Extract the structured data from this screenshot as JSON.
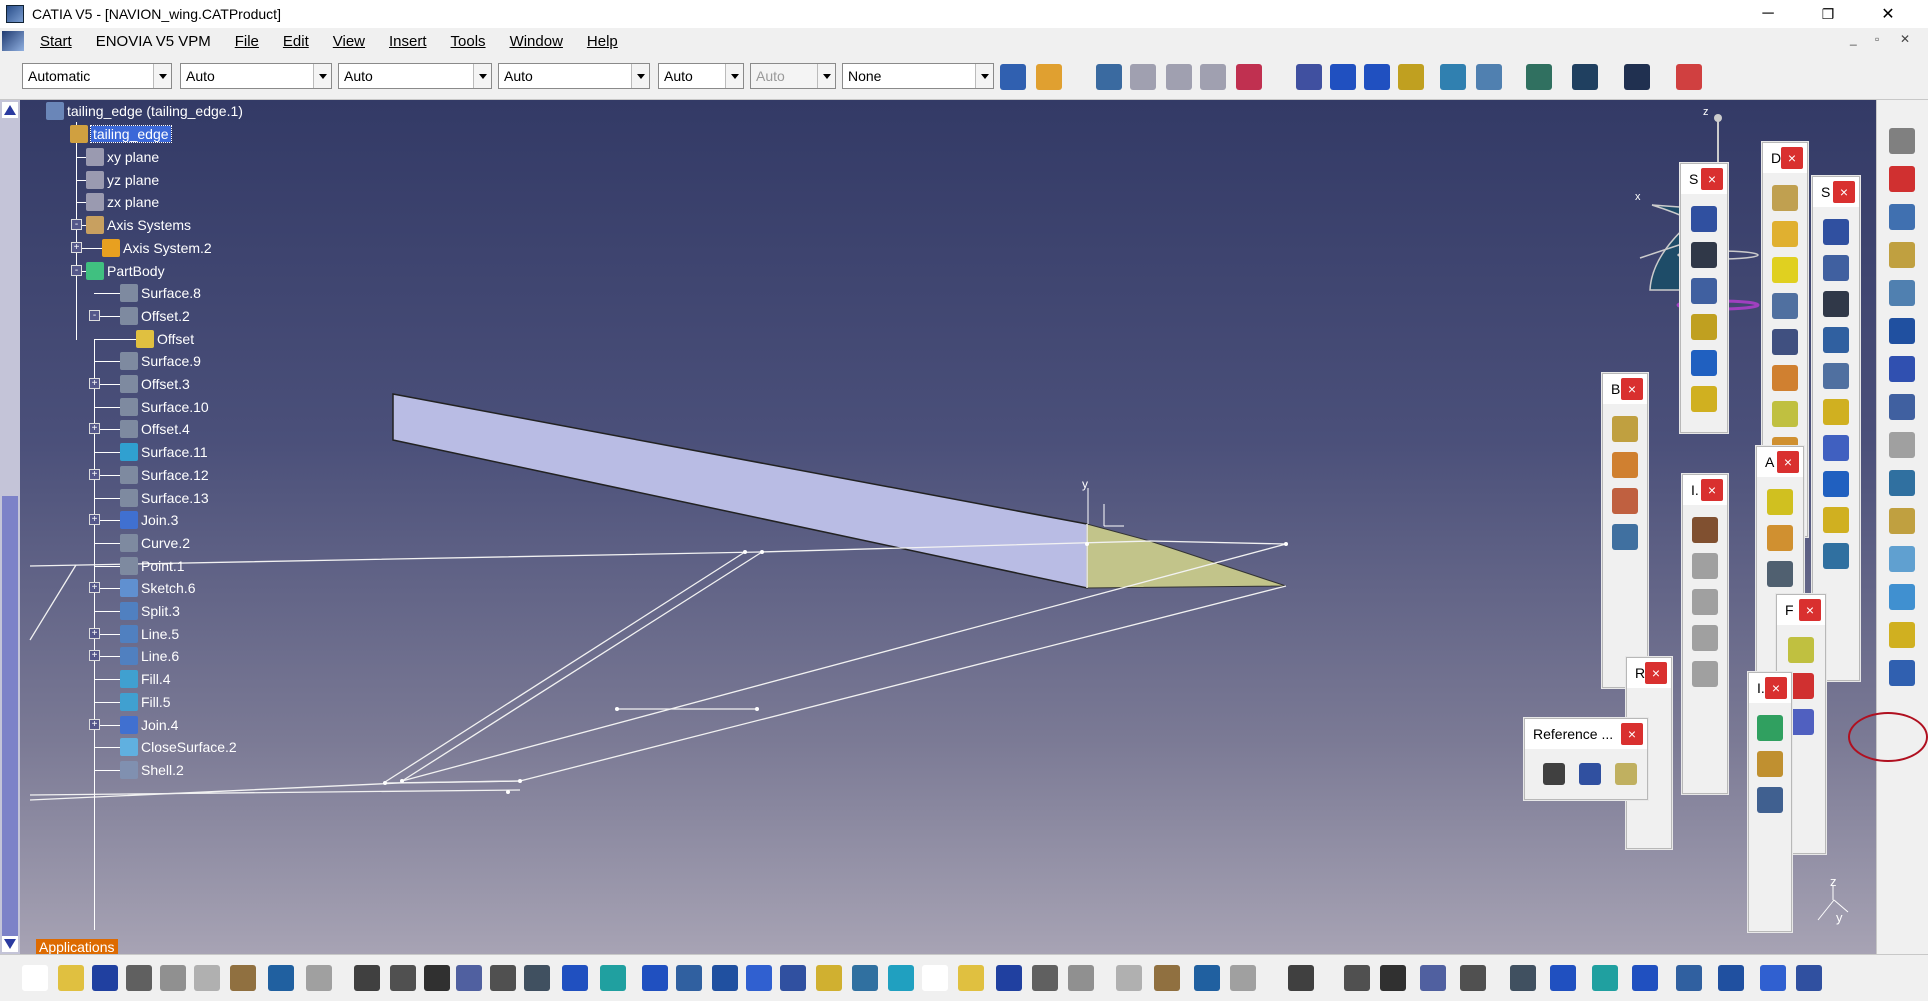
{
  "window": {
    "title": "CATIA V5 - [NAVION_wing.CATProduct]",
    "controls": [
      "─",
      "❐",
      "✕"
    ],
    "doc_controls": [
      "_",
      "▫",
      "✕"
    ]
  },
  "menu": {
    "items": [
      "Start",
      "ENOVIA V5 VPM",
      "File",
      "Edit",
      "View",
      "Insert",
      "Tools",
      "Window",
      "Help"
    ]
  },
  "toolbar": {
    "combos": [
      "Automatic",
      "Auto",
      "Auto",
      "Auto",
      "Auto",
      "Auto",
      "None"
    ],
    "combo_disabled": [
      false,
      false,
      false,
      false,
      false,
      true,
      false
    ]
  },
  "tree": {
    "root": "tailing_edge (tailing_edge.1)",
    "part": "tailing_edge",
    "nodes": [
      {
        "label": "xy plane",
        "icon": "plane-icon",
        "color": "#9a9ab0",
        "expander": ""
      },
      {
        "label": "yz plane",
        "icon": "plane-icon",
        "color": "#9a9ab0",
        "expander": ""
      },
      {
        "label": "zx plane",
        "icon": "plane-icon",
        "color": "#9a9ab0",
        "expander": ""
      },
      {
        "label": "Axis Systems",
        "icon": "axis-systems-icon",
        "color": "#c8a060",
        "expander": "-"
      },
      {
        "label": "Axis System.2",
        "icon": "axis-system-icon",
        "color": "#e8a020",
        "expander": "+"
      },
      {
        "label": "PartBody",
        "icon": "partbody-icon",
        "color": "#40c080",
        "expander": "-"
      },
      {
        "label": "Surface.8",
        "icon": "surface-icon",
        "color": "#7e8aa0",
        "expander": ""
      },
      {
        "label": "Offset.2",
        "icon": "offset-icon",
        "color": "#7e8aa0",
        "expander": "-"
      },
      {
        "label": "Offset",
        "icon": "offset-feature-icon",
        "color": "#e0c040",
        "expander": ""
      },
      {
        "label": "Surface.9",
        "icon": "surface-icon",
        "color": "#7e8aa0",
        "expander": ""
      },
      {
        "label": "Offset.3",
        "icon": "offset-icon",
        "color": "#7e8aa0",
        "expander": "+"
      },
      {
        "label": "Surface.10",
        "icon": "surface-icon",
        "color": "#7e8aa0",
        "expander": ""
      },
      {
        "label": "Offset.4",
        "icon": "offset-icon",
        "color": "#7e8aa0",
        "expander": "+"
      },
      {
        "label": "Surface.11",
        "icon": "surface-icon",
        "color": "#30a0d0",
        "expander": ""
      },
      {
        "label": "Surface.12",
        "icon": "surface-icon",
        "color": "#7e8aa0",
        "expander": "+"
      },
      {
        "label": "Surface.13",
        "icon": "surface-icon",
        "color": "#7e8aa0",
        "expander": ""
      },
      {
        "label": "Join.3",
        "icon": "join-icon",
        "color": "#4070d0",
        "expander": "+"
      },
      {
        "label": "Curve.2",
        "icon": "curve-icon",
        "color": "#7e8aa0",
        "expander": ""
      },
      {
        "label": "Point.1",
        "icon": "point-icon",
        "color": "#7e8aa0",
        "expander": ""
      },
      {
        "label": "Sketch.6",
        "icon": "sketch-icon",
        "color": "#6090d0",
        "expander": "+"
      },
      {
        "label": "Split.3",
        "icon": "split-icon",
        "color": "#5080c0",
        "expander": ""
      },
      {
        "label": "Line.5",
        "icon": "line-icon",
        "color": "#5080c0",
        "expander": "+"
      },
      {
        "label": "Line.6",
        "icon": "line-icon",
        "color": "#5080c0",
        "expander": "+"
      },
      {
        "label": "Fill.4",
        "icon": "fill-icon",
        "color": "#40a0d0",
        "expander": ""
      },
      {
        "label": "Fill.5",
        "icon": "fill-icon",
        "color": "#40a0d0",
        "expander": ""
      },
      {
        "label": "Join.4",
        "icon": "join-icon",
        "color": "#4070d0",
        "expander": "+"
      },
      {
        "label": "CloseSurface.2",
        "icon": "close-surface-icon",
        "color": "#60b0e0",
        "expander": ""
      },
      {
        "label": "Shell.2",
        "icon": "shell-icon",
        "color": "#8090b0",
        "expander": ""
      }
    ],
    "applications_label": "Applications"
  },
  "palettes": [
    {
      "title": "S",
      "icons": [
        "#3050a0",
        "#303848",
        "#4060a0",
        "#c0a020",
        "#2060c0",
        "#d0b020"
      ]
    },
    {
      "title": "D",
      "icons": [
        "#c0a050",
        "#e0b030",
        "#e0d020",
        "#5070a0",
        "#405080",
        "#d08030",
        "#c0c040",
        "#d09030"
      ]
    },
    {
      "title": "S",
      "icons": [
        "#3050a0",
        "#4060a0",
        "#303848",
        "#3060a0",
        "#5070a0",
        "#d0b020",
        "#4060c0",
        "#2060c0",
        "#d0b020",
        "#3070a0"
      ]
    },
    {
      "title": "B",
      "icons": [
        "#c0a040",
        "#d08030",
        "#c06040",
        "#4070a0"
      ]
    },
    {
      "title": "I.",
      "icons": [
        "#805030",
        "#a0a0a0",
        "#a0a0a0",
        "#a0a0a0",
        "#a0a0a0"
      ]
    },
    {
      "title": "A",
      "icons": [
        "#d0c020",
        "#d09030",
        "#506070"
      ]
    },
    {
      "title": "F",
      "icons": [
        "#c0c040",
        "#d03030",
        "#5060c0"
      ]
    },
    {
      "title": "R",
      "icons": []
    },
    {
      "title": "I.",
      "icons": [
        "#30a060",
        "#c09030",
        "#406090"
      ]
    },
    {
      "title": "Reference ...",
      "icons": [
        "#404040",
        "#3050a0",
        "#c0b060"
      ]
    }
  ],
  "compass": {
    "z_label": "z",
    "x_label": "x"
  },
  "axis_indicator": {
    "z_label": "z",
    "y_label": "y"
  },
  "model_label": {
    "y_label": "y"
  }
}
